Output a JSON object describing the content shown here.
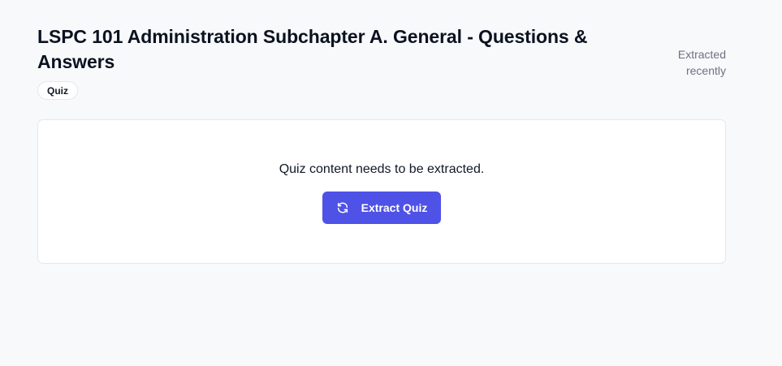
{
  "header": {
    "title": "LSPC 101 Administration Subchapter A. General - Questions & Answers",
    "badge": "Quiz",
    "status": "Extracted recently"
  },
  "card": {
    "message": "Quiz content needs to be extracted.",
    "button_label": "Extract Quiz",
    "button_icon": "refresh-icon"
  },
  "colors": {
    "accent": "#4f52e6",
    "page_background": "#f8f9fb",
    "muted_text": "#6b7280"
  }
}
